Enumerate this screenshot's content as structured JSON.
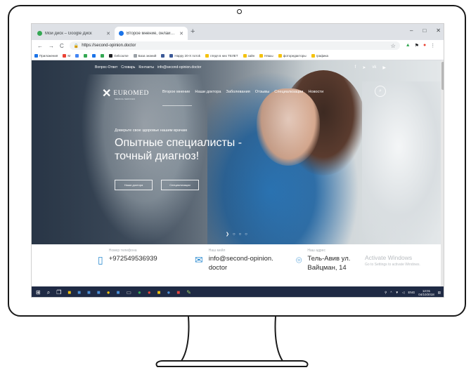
{
  "browser": {
    "tabs": [
      {
        "title": "Мой диск – Google Диск",
        "active": false,
        "icon": "google-drive-icon"
      },
      {
        "title": "Второе мнение, онлайн консул",
        "active": true,
        "icon": "site-favicon"
      }
    ],
    "new_tab": "+",
    "window_controls": [
      "–",
      "□",
      "✕"
    ],
    "url": "https://second-opinion.doctor",
    "bookmarks": [
      {
        "label": "Приложения",
        "color": "#1a73e8"
      },
      {
        "label": "M",
        "color": "#ea4335"
      },
      {
        "label": "",
        "color": "#4285f4"
      },
      {
        "label": "",
        "color": "#34a853"
      },
      {
        "label": "",
        "color": "#1a73e8"
      },
      {
        "label": "",
        "color": "#34a853"
      },
      {
        "label": "Gelcourse",
        "color": "#202124"
      },
      {
        "label": "База знаний",
        "color": "#9aa0a6"
      },
      {
        "label": "",
        "color": "#3b5998"
      },
      {
        "label": "Нappy 20-X потоk",
        "color": "#3b5998"
      },
      {
        "label": "глядя в них ТЕЛЕТ",
        "color": "#f4c20d"
      },
      {
        "label": "зайн",
        "color": "#f4c20d"
      },
      {
        "label": "Няшы",
        "color": "#f4c20d"
      },
      {
        "label": "фоторедакторы",
        "color": "#f4c20d"
      },
      {
        "label": "графика",
        "color": "#f4c20d"
      }
    ]
  },
  "site": {
    "top_links": [
      "Вопрос-Ответ",
      "Словарь",
      "Контакты",
      "info@second-opinion.doctor"
    ],
    "social": [
      "f",
      "➤",
      "vk",
      "▶"
    ],
    "logo": {
      "name": "EUROMED",
      "sub": "MEDICAL SERVICES"
    },
    "nav": [
      "Второе мнение",
      "Наши доктора",
      "Заболевания",
      "Отзывы",
      "Специализации",
      "Новости"
    ],
    "hero": {
      "eyebrow": "Доверьте свое здоровье нашим врачам",
      "headline": "Опытные специалисты - точный диагноз!",
      "buttons": [
        "Наши доктора",
        "Специализации"
      ],
      "slider": [
        "❯",
        "○",
        "○",
        "○"
      ]
    },
    "contacts": [
      {
        "label": "Номер телефона",
        "value": "+972549536939",
        "icon": "phone-icon"
      },
      {
        "label": "Наш мейл",
        "value": "info@second-opinion. doctor",
        "icon": "mail-icon"
      },
      {
        "label": "Наш адрес",
        "value": "Тель-Авив ул. Вайцман, 14",
        "icon": "location-icon"
      }
    ],
    "activate": {
      "title": "Activate Windows",
      "subtitle": "Go to Settings to activate Windows."
    }
  },
  "taskbar": {
    "tray_lang": "ENG",
    "time": "12:01",
    "date": "04/10/2018"
  }
}
